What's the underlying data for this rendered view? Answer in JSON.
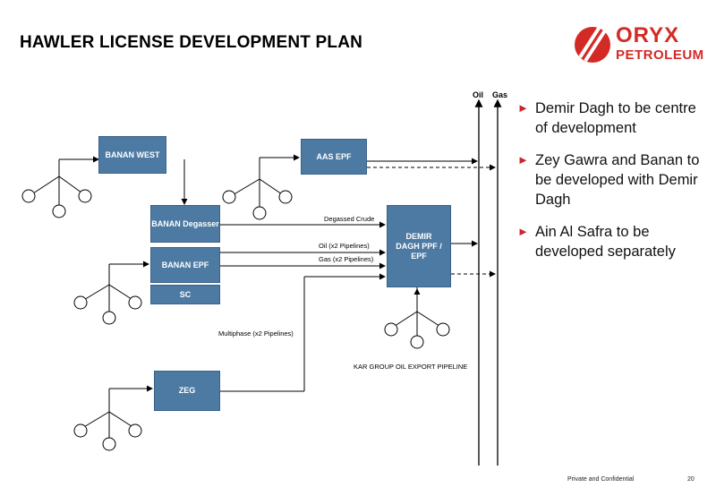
{
  "title": "HAWLER LICENSE DEVELOPMENT PLAN",
  "logo": {
    "word1": "ORYX",
    "word2": "PETROLEUM",
    "color": "#d42a25"
  },
  "boxes": {
    "banan_west": "BANAN WEST",
    "aas_epf": "AAS EPF",
    "banan_degasser": "BANAN Degasser",
    "banan_epf": "BANAN EPF",
    "sc": "SC",
    "demir_dagh": "DEMIR DAGH PPF / EPF",
    "zeg": "ZEG"
  },
  "labels": {
    "degassed_crude": "Degassed Crude",
    "oil_pipelines": "Oil (x2 Pipelines)",
    "gas_pipelines": "Gas (x2 Pipelines)",
    "multiphase": "Multiphase (x2 Pipelines)",
    "kar_pipeline": "KAR GROUP OIL EXPORT PIPELINE",
    "oil": "Oil",
    "gas": "Gas"
  },
  "bullets": [
    "Demir Dagh to be centre of development",
    "Zey Gawra and Banan to be developed with Demir Dagh",
    "Ain Al Safra to be developed separately"
  ],
  "footer": {
    "confidential": "Private and Confidential",
    "page": "20"
  },
  "colors": {
    "box": "#4d7aa3",
    "bullet_arrow": "#c9252b"
  }
}
